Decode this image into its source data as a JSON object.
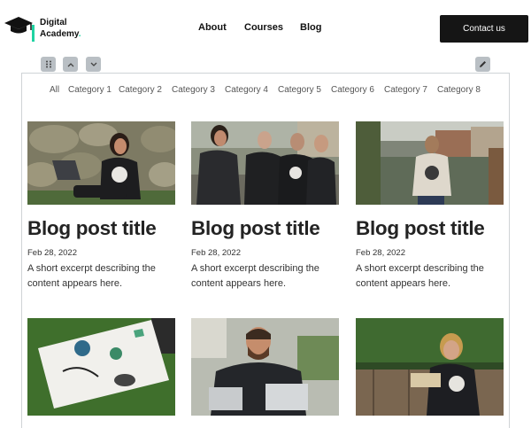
{
  "header": {
    "logo_line1": "Digital",
    "logo_line2": "Academy",
    "logo_dot": ".",
    "nav": [
      "About",
      "Courses",
      "Blog"
    ],
    "cta_label": "Contact us"
  },
  "toolbar": {
    "drag_icon": "grip-dots-icon",
    "up_icon": "chevron-up-icon",
    "down_icon": "chevron-down-icon",
    "edit_icon": "pencil-icon"
  },
  "categories": [
    "All",
    "Category 1",
    "Category 2",
    "Category 3",
    "Category 4",
    "Category 5",
    "Category 6",
    "Category 7",
    "Category 8"
  ],
  "posts": [
    {
      "title": "Blog post title",
      "date": "Feb 28, 2022",
      "excerpt": "A short excerpt describing the content appears here."
    },
    {
      "title": "Blog post title",
      "date": "Feb 28, 2022",
      "excerpt": "A short excerpt describing the content appears here."
    },
    {
      "title": "Blog post title",
      "date": "Feb 28, 2022",
      "excerpt": "A short excerpt describing the content appears here."
    }
  ],
  "colors": {
    "accent": "#1fd3a2",
    "button": "#151515",
    "tool": "#b9bfc4"
  }
}
